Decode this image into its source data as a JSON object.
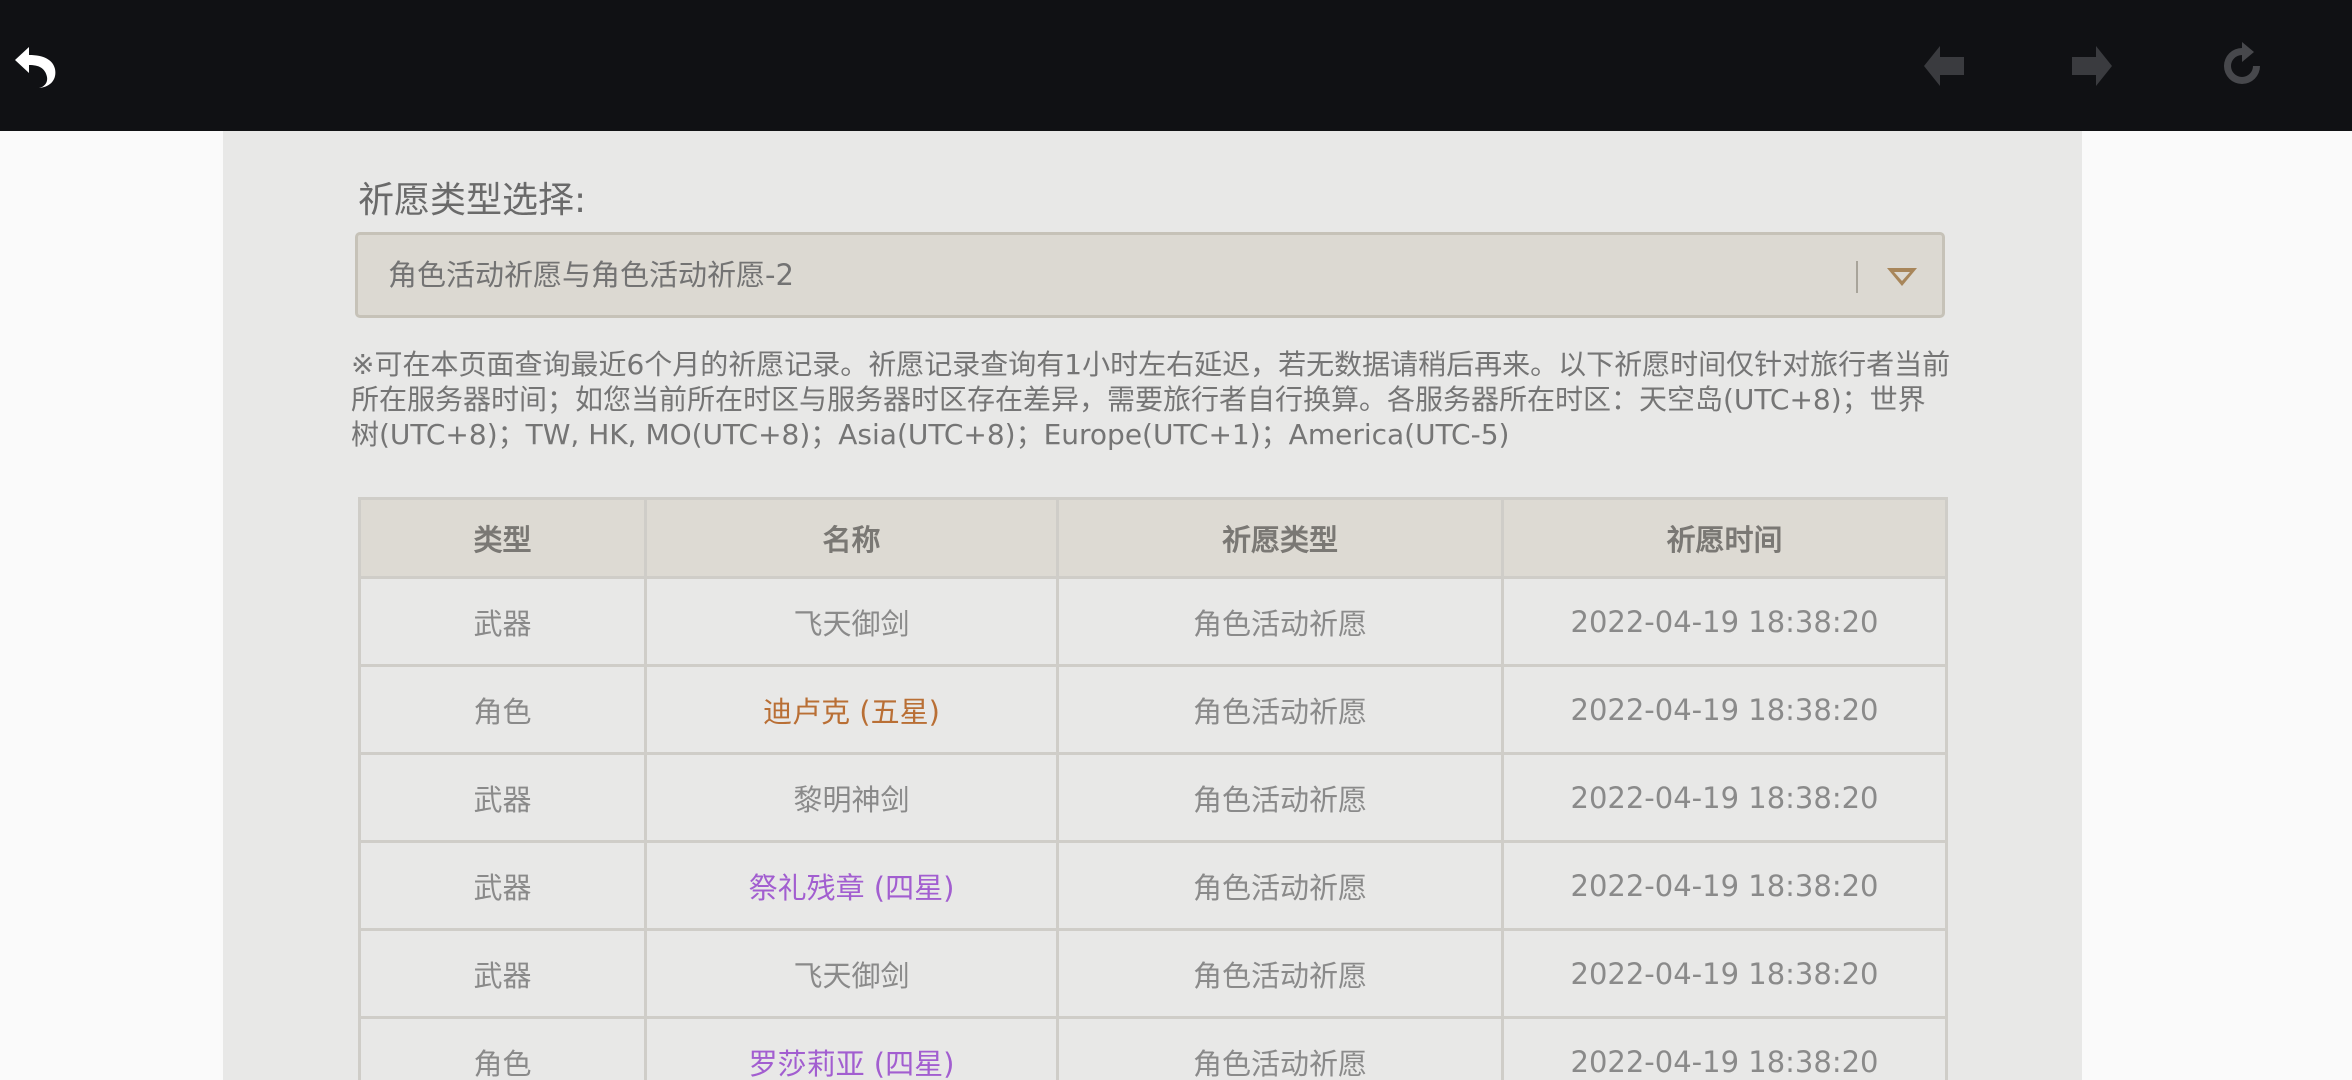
{
  "toolbar": {
    "back_icon": "back-arrow-icon",
    "prev_icon": "diamond-left-icon",
    "next_icon": "diamond-right-icon",
    "reload_icon": "reload-icon"
  },
  "wish_select": {
    "label": "祈愿类型选择:",
    "value": "角色活动祈愿与角色活动祈愿-2",
    "arrow_icon": "chevron-down-icon"
  },
  "notice": "※可在本页面查询最近6个月的祈愿记录。祈愿记录查询有1小时左右延迟，若无数据请稍后再来。以下祈愿时间仅针对旅行者当前所在服务器时间；如您当前所在时区与服务器时区存在差异，需要旅行者自行换算。各服务器所在时区：天空岛(UTC+8)；世界树(UTC+8)；TW, HK, MO(UTC+8)；Asia(UTC+8)；Europe(UTC+1)；America(UTC-5)",
  "table": {
    "headers": [
      "类型",
      "名称",
      "祈愿类型",
      "祈愿时间"
    ],
    "rows": [
      {
        "type": "武器",
        "name": "飞天御剑",
        "wish": "角色活动祈愿",
        "time": "2022-04-19 18:38:20"
      },
      {
        "type": "角色",
        "name": "迪卢克 (五星)",
        "wish": "角色活动祈愿",
        "time": "2022-04-19 18:38:20"
      },
      {
        "type": "武器",
        "name": "黎明神剑",
        "wish": "角色活动祈愿",
        "time": "2022-04-19 18:38:20"
      },
      {
        "type": "武器",
        "name": "祭礼残章 (四星)",
        "wish": "角色活动祈愿",
        "time": "2022-04-19 18:38:20"
      },
      {
        "type": "武器",
        "name": "飞天御剑",
        "wish": "角色活动祈愿",
        "time": "2022-04-19 18:38:20"
      },
      {
        "type": "角色",
        "name": "罗莎莉亚 (四星)",
        "wish": "角色活动祈愿",
        "time": "2022-04-19 18:38:20"
      }
    ]
  },
  "colors": {
    "five_star": "#b96f35",
    "four_star": "#a25ed0",
    "toolbar_bg": "#101114"
  }
}
